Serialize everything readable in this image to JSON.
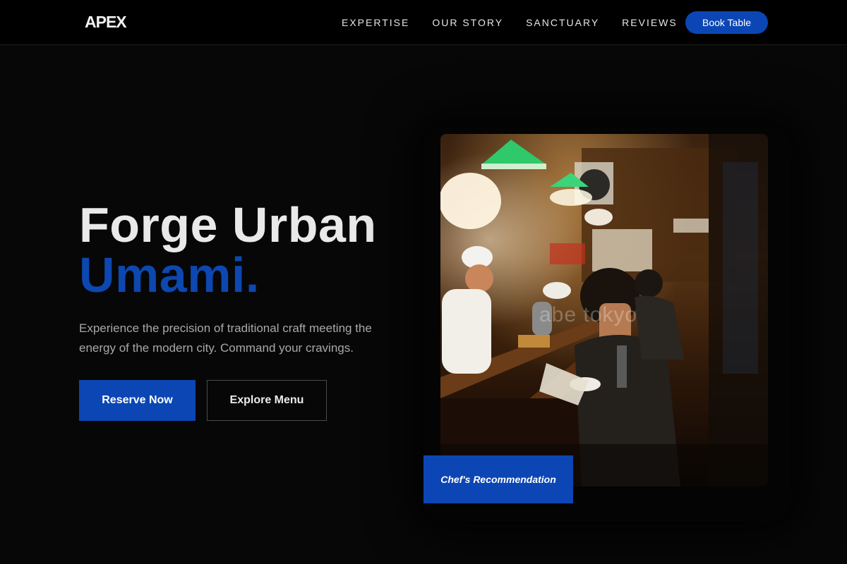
{
  "brand": {
    "name": "APEX"
  },
  "nav": {
    "items": [
      {
        "label": "EXPERTISE"
      },
      {
        "label": "OUR STORY"
      },
      {
        "label": "SANCTUARY"
      },
      {
        "label": "REVIEWS"
      }
    ],
    "cta_label": "Book Table"
  },
  "hero": {
    "headline_line1": "Forge Urban",
    "headline_line2": "Umami.",
    "description": "Experience the precision of traditional craft meeting the energy of the modern city. Command your cravings.",
    "primary_button": "Reserve Now",
    "secondary_button": "Explore Menu",
    "image": {
      "watermark": "abe tokyo",
      "badge": "Chef's Recommendation"
    }
  },
  "colors": {
    "accent": "#0b46b4",
    "background": "#070707",
    "header_bg": "#000000",
    "text_primary": "#e9e9e9",
    "text_muted": "#a8a8a8"
  }
}
